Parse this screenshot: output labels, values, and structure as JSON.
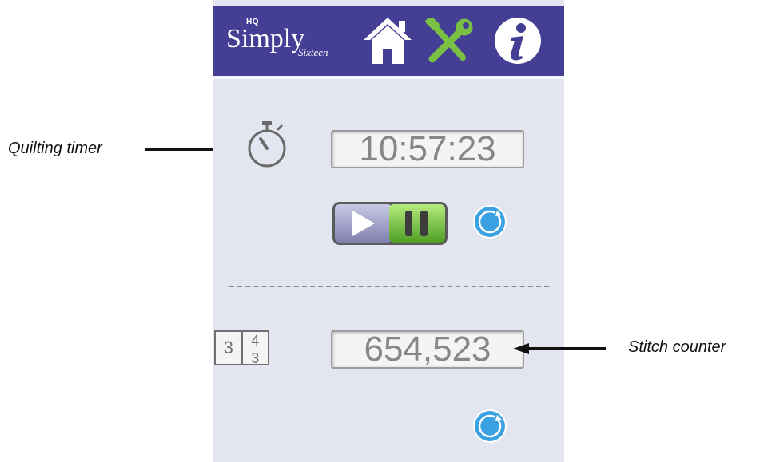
{
  "header": {
    "brand_hq": "HQ",
    "brand_name": "Simply",
    "brand_sub": "Sixteen",
    "icons": [
      "home-icon",
      "tools-icon",
      "info-icon"
    ],
    "colors": {
      "bar": "#443f95",
      "home": "#ffffff",
      "tools": "#7ac143",
      "info": "#ffffff"
    }
  },
  "timer": {
    "icon": "stopwatch-icon",
    "value": "10:57:23",
    "play_pause_state": "running",
    "reset_icon": "reset-icon"
  },
  "stitch_counter": {
    "icon": "counter-icon",
    "icon_digits": [
      "3",
      "4",
      "3"
    ],
    "value": "654,523",
    "reset_icon": "reset-icon"
  },
  "annotations": {
    "timer_label": "Quilting timer",
    "counter_label": "Stitch counter"
  }
}
